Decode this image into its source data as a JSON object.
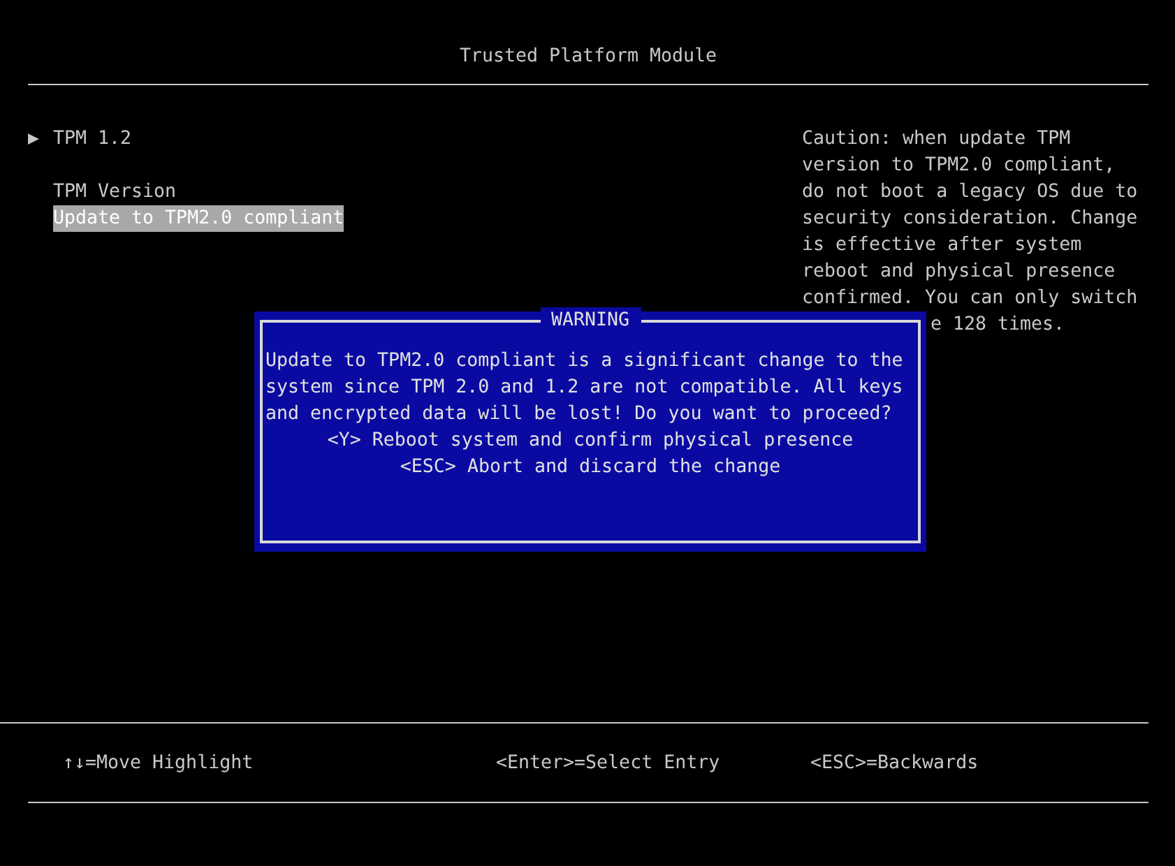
{
  "window": {
    "title": "Trusted Platform Module"
  },
  "submenu": {
    "marker": "▶",
    "label": "TPM 1.2"
  },
  "items": [
    {
      "label": "TPM Version",
      "selected": false
    },
    {
      "label": "Update to TPM2.0 compliant",
      "selected": true
    }
  ],
  "help_lines": [
    "Caution: when update TPM",
    "version to TPM2.0 compliant,",
    "do not boot a legacy OS due to",
    "security consideration. Change",
    "is effective after system",
    "reboot and physical presence",
    "confirmed. You can only switch",
    "e 128 times."
  ],
  "dialog": {
    "title": "WARNING",
    "message_lines": [
      "Update to TPM2.0 compliant is a significant change to the",
      "system since TPM 2.0 and 1.2 are not compatible. All keys",
      "and encrypted data will be lost! Do you want to proceed?"
    ],
    "options": [
      "<Y> Reboot system and confirm physical presence",
      "<ESC> Abort and discard the change"
    ]
  },
  "status_bar": [
    "↑↓=Move Highlight",
    "<Enter>=Select Entry",
    "<ESC>=Backwards"
  ]
}
